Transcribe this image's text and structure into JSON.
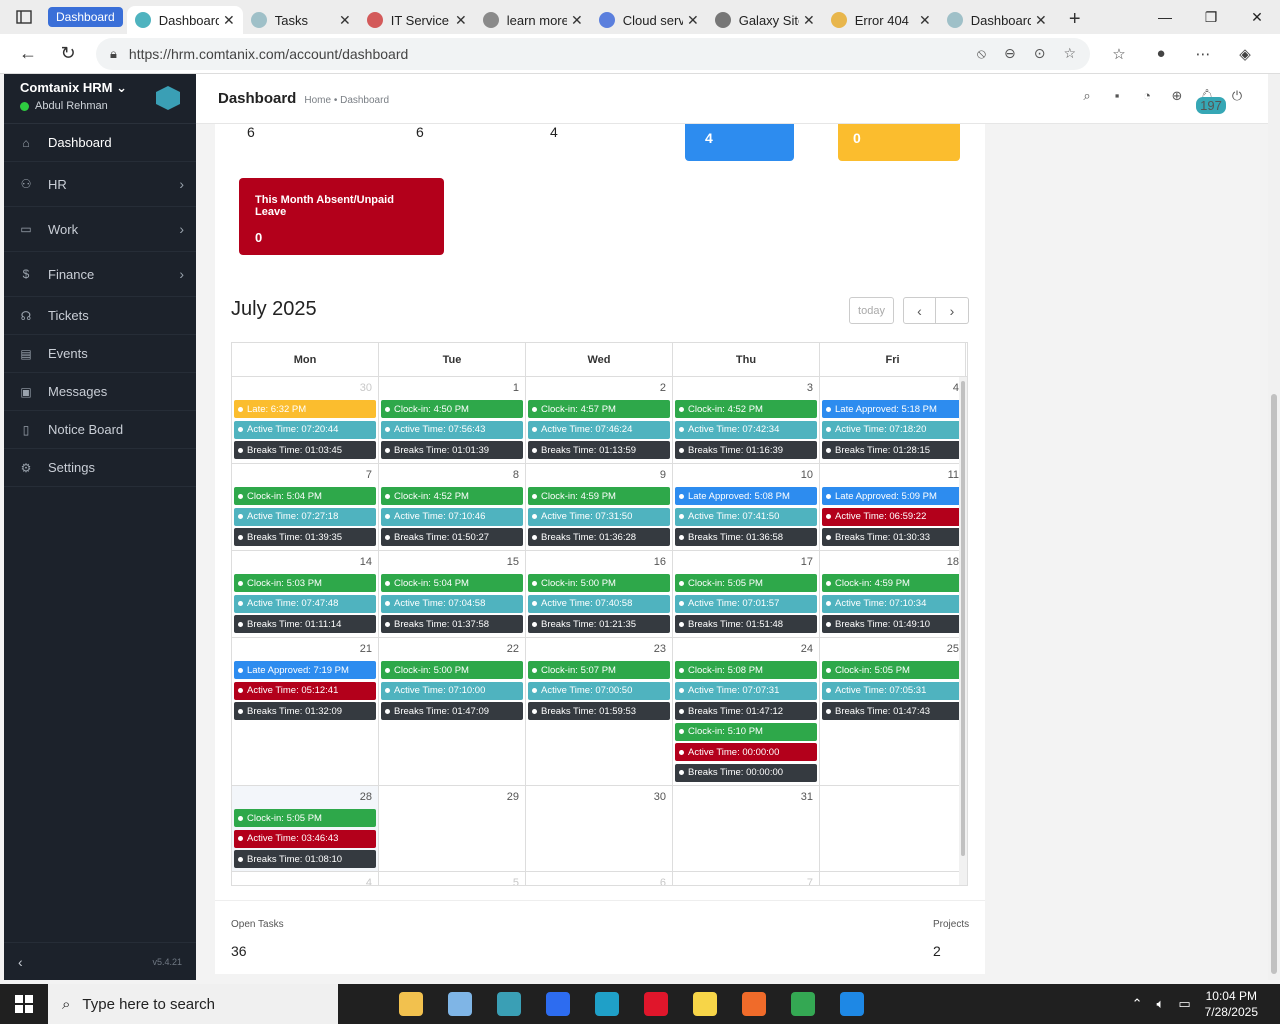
{
  "browser": {
    "tab_group": "Dashboard",
    "tabs": [
      {
        "title": "Dashboard",
        "color": "#4fb3bf",
        "active": true
      },
      {
        "title": "Tasks",
        "color": "#9fc0c8",
        "active": false
      },
      {
        "title": "IT Service",
        "color": "#d35a5a",
        "active": false
      },
      {
        "title": "learn more",
        "color": "#8a8a8a",
        "active": false
      },
      {
        "title": "Cloud serv",
        "color": "#5b7fdd",
        "active": false
      },
      {
        "title": "Galaxy Site",
        "color": "#777777",
        "active": false
      },
      {
        "title": "Error 404",
        "color": "#e8b64c",
        "active": false
      },
      {
        "title": "Dashboard",
        "color": "#9fc0c8",
        "active": false
      }
    ],
    "url": "https://hrm.comtanix.com/account/dashboard"
  },
  "sidebar": {
    "company": "Comtanix HRM",
    "user": "Abdul Rehman",
    "items": [
      {
        "label": "Dashboard",
        "icon": "home-icon",
        "glyph": "⌂",
        "chevron": false,
        "active": true
      },
      {
        "label": "HR",
        "icon": "users-icon",
        "glyph": "⚇",
        "chevron": true,
        "active": false
      },
      {
        "label": "Work",
        "icon": "briefcase-icon",
        "glyph": "▭",
        "chevron": true,
        "active": false
      },
      {
        "label": "Finance",
        "icon": "dollar-icon",
        "glyph": "$",
        "chevron": true,
        "active": false
      },
      {
        "label": "Tickets",
        "icon": "headset-icon",
        "glyph": "☊",
        "chevron": false,
        "active": false
      },
      {
        "label": "Events",
        "icon": "calendar-icon",
        "glyph": "▤",
        "chevron": false,
        "active": false
      },
      {
        "label": "Messages",
        "icon": "message-icon",
        "glyph": "▣",
        "chevron": false,
        "active": false
      },
      {
        "label": "Notice Board",
        "icon": "clipboard-icon",
        "glyph": "▯",
        "chevron": false,
        "active": false
      },
      {
        "label": "Settings",
        "icon": "gear-icon",
        "glyph": "⚙",
        "chevron": false,
        "active": false
      }
    ],
    "version": "v5.4.21"
  },
  "header": {
    "title": "Dashboard",
    "breadcrumb": "Home • Dashboard",
    "notification_count": "197"
  },
  "stats_top": {
    "values": [
      "6",
      "6",
      "4"
    ],
    "blue_value": "4",
    "yellow_value": "0"
  },
  "absent": {
    "label": "This Month Absent/Unpaid Leave",
    "value": "0"
  },
  "calendar": {
    "month": "July 2025",
    "today_label": "today",
    "days": [
      "Mon",
      "Tue",
      "Wed",
      "Thu",
      "Fri"
    ],
    "weeks": [
      [
        {
          "day": "30",
          "muted": true,
          "events": [
            [
              "yellow",
              "Late: 6:32 PM"
            ],
            [
              "teal",
              "Active Time: 07:20:44"
            ],
            [
              "dark",
              "Breaks Time: 01:03:45"
            ]
          ]
        },
        {
          "day": "1",
          "events": [
            [
              "green",
              "Clock-in: 4:50 PM"
            ],
            [
              "teal",
              "Active Time: 07:56:43"
            ],
            [
              "dark",
              "Breaks Time: 01:01:39"
            ]
          ]
        },
        {
          "day": "2",
          "events": [
            [
              "green",
              "Clock-in: 4:57 PM"
            ],
            [
              "teal",
              "Active Time: 07:46:24"
            ],
            [
              "dark",
              "Breaks Time: 01:13:59"
            ]
          ]
        },
        {
          "day": "3",
          "events": [
            [
              "green",
              "Clock-in: 4:52 PM"
            ],
            [
              "teal",
              "Active Time: 07:42:34"
            ],
            [
              "dark",
              "Breaks Time: 01:16:39"
            ]
          ]
        },
        {
          "day": "4",
          "events": [
            [
              "blue",
              "Late Approved: 5:18 PM"
            ],
            [
              "teal",
              "Active Time: 07:18:20"
            ],
            [
              "dark",
              "Breaks Time: 01:28:15"
            ]
          ]
        }
      ],
      [
        {
          "day": "7",
          "events": [
            [
              "green",
              "Clock-in: 5:04 PM"
            ],
            [
              "teal",
              "Active Time: 07:27:18"
            ],
            [
              "dark",
              "Breaks Time: 01:39:35"
            ]
          ]
        },
        {
          "day": "8",
          "events": [
            [
              "green",
              "Clock-in: 4:52 PM"
            ],
            [
              "teal",
              "Active Time: 07:10:46"
            ],
            [
              "dark",
              "Breaks Time: 01:50:27"
            ]
          ]
        },
        {
          "day": "9",
          "events": [
            [
              "green",
              "Clock-in: 4:59 PM"
            ],
            [
              "teal",
              "Active Time: 07:31:50"
            ],
            [
              "dark",
              "Breaks Time: 01:36:28"
            ]
          ]
        },
        {
          "day": "10",
          "events": [
            [
              "blue",
              "Late Approved: 5:08 PM"
            ],
            [
              "teal",
              "Active Time: 07:41:50"
            ],
            [
              "dark",
              "Breaks Time: 01:36:58"
            ]
          ]
        },
        {
          "day": "11",
          "events": [
            [
              "blue",
              "Late Approved: 5:09 PM"
            ],
            [
              "red",
              "Active Time: 06:59:22"
            ],
            [
              "dark",
              "Breaks Time: 01:30:33"
            ]
          ]
        }
      ],
      [
        {
          "day": "14",
          "events": [
            [
              "green",
              "Clock-in: 5:03 PM"
            ],
            [
              "teal",
              "Active Time: 07:47:48"
            ],
            [
              "dark",
              "Breaks Time: 01:11:14"
            ]
          ]
        },
        {
          "day": "15",
          "events": [
            [
              "green",
              "Clock-in: 5:04 PM"
            ],
            [
              "teal",
              "Active Time: 07:04:58"
            ],
            [
              "dark",
              "Breaks Time: 01:37:58"
            ]
          ]
        },
        {
          "day": "16",
          "events": [
            [
              "green",
              "Clock-in: 5:00 PM"
            ],
            [
              "teal",
              "Active Time: 07:40:58"
            ],
            [
              "dark",
              "Breaks Time: 01:21:35"
            ]
          ]
        },
        {
          "day": "17",
          "events": [
            [
              "green",
              "Clock-in: 5:05 PM"
            ],
            [
              "teal",
              "Active Time: 07:01:57"
            ],
            [
              "dark",
              "Breaks Time: 01:51:48"
            ]
          ]
        },
        {
          "day": "18",
          "events": [
            [
              "green",
              "Clock-in: 4:59 PM"
            ],
            [
              "teal",
              "Active Time: 07:10:34"
            ],
            [
              "dark",
              "Breaks Time: 01:49:10"
            ]
          ]
        }
      ],
      [
        {
          "day": "21",
          "events": [
            [
              "blue",
              "Late Approved: 7:19 PM"
            ],
            [
              "red",
              "Active Time: 05:12:41"
            ],
            [
              "dark",
              "Breaks Time: 01:32:09"
            ]
          ]
        },
        {
          "day": "22",
          "events": [
            [
              "green",
              "Clock-in: 5:00 PM"
            ],
            [
              "teal",
              "Active Time: 07:10:00"
            ],
            [
              "dark",
              "Breaks Time: 01:47:09"
            ]
          ]
        },
        {
          "day": "23",
          "events": [
            [
              "green",
              "Clock-in: 5:07 PM"
            ],
            [
              "teal",
              "Active Time: 07:00:50"
            ],
            [
              "dark",
              "Breaks Time: 01:59:53"
            ]
          ]
        },
        {
          "day": "24",
          "events": [
            [
              "green",
              "Clock-in: 5:08 PM"
            ],
            [
              "teal",
              "Active Time: 07:07:31"
            ],
            [
              "dark",
              "Breaks Time: 01:47:12"
            ],
            [
              "green",
              "Clock-in: 5:10 PM"
            ],
            [
              "red",
              "Active Time: 00:00:00"
            ],
            [
              "dark",
              "Breaks Time: 00:00:00"
            ]
          ]
        },
        {
          "day": "25",
          "events": [
            [
              "green",
              "Clock-in: 5:05 PM"
            ],
            [
              "teal",
              "Active Time: 07:05:31"
            ],
            [
              "dark",
              "Breaks Time: 01:47:43"
            ]
          ]
        }
      ],
      [
        {
          "day": "28",
          "today": true,
          "events": [
            [
              "green",
              "Clock-in: 5:05 PM"
            ],
            [
              "red",
              "Active Time: 03:46:43"
            ],
            [
              "dark",
              "Breaks Time: 01:08:10"
            ]
          ]
        },
        {
          "day": "29",
          "events": []
        },
        {
          "day": "30",
          "events": []
        },
        {
          "day": "31",
          "events": []
        },
        {
          "day": "",
          "events": []
        }
      ],
      [
        {
          "day": "4",
          "muted": true,
          "events": []
        },
        {
          "day": "5",
          "muted": true,
          "events": []
        },
        {
          "day": "6",
          "muted": true,
          "events": []
        },
        {
          "day": "7",
          "muted": true,
          "events": []
        },
        {
          "day": "",
          "muted": true,
          "events": []
        }
      ]
    ]
  },
  "bottom": {
    "open_tasks_label": "Open Tasks",
    "open_tasks_value": "36",
    "projects_label": "Projects",
    "projects_value": "2"
  },
  "taskbar": {
    "search_placeholder": "Type here to search",
    "time": "10:04 PM",
    "date": "7/28/2025",
    "apps": [
      {
        "name": "file-explorer-icon",
        "color": "#f2c14e"
      },
      {
        "name": "paint-icon",
        "color": "#7fb5e6"
      },
      {
        "name": "hrm-app-icon",
        "color": "#3a9fb5"
      },
      {
        "name": "zoom-icon",
        "color": "#2d6cf0"
      },
      {
        "name": "edge-icon",
        "color": "#1fa0c8"
      },
      {
        "name": "opera-icon",
        "color": "#e0162b"
      },
      {
        "name": "sticky-notes-icon",
        "color": "#f7d548"
      },
      {
        "name": "firefox-icon",
        "color": "#f06b2a"
      },
      {
        "name": "chrome-icon",
        "color": "#34a853"
      },
      {
        "name": "vscode-icon",
        "color": "#1e88e5"
      }
    ]
  }
}
